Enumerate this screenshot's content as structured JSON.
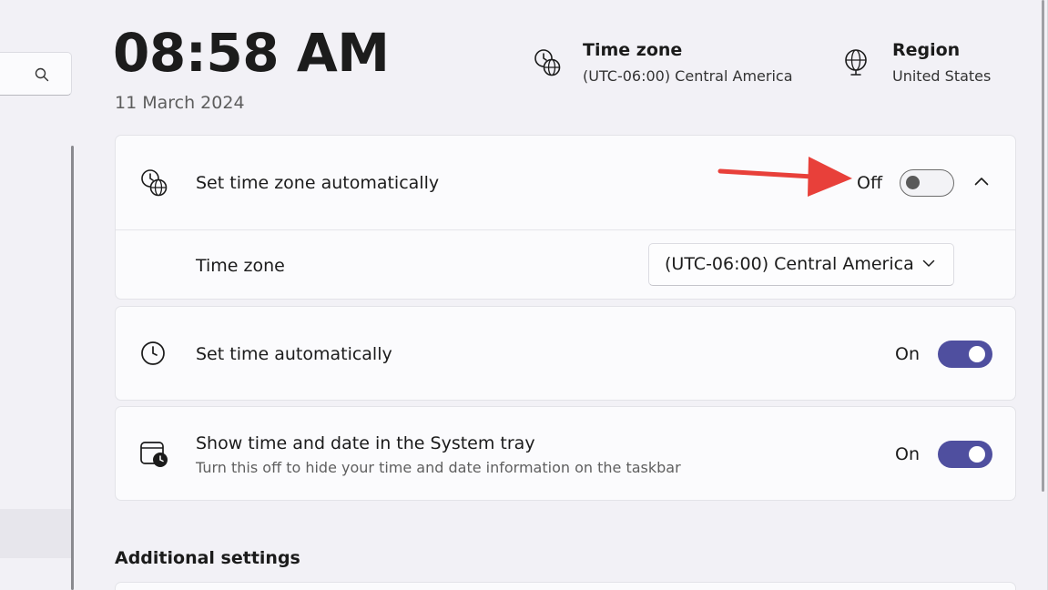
{
  "header": {
    "time": "08:58 AM",
    "date": "11 March 2024",
    "timezone": {
      "title": "Time zone",
      "value": "(UTC-06:00) Central America",
      "icon": "clock-globe-icon"
    },
    "region": {
      "title": "Region",
      "value": "United States",
      "icon": "globe-icon"
    }
  },
  "nav": {
    "search_icon": "search-icon"
  },
  "settings": {
    "auto_timezone": {
      "label": "Set time zone automatically",
      "state": "Off",
      "on": false,
      "icon": "clock-globe-icon",
      "expand_icon": "chevron-up-icon"
    },
    "timezone": {
      "label": "Time zone",
      "value": "(UTC-06:00) Central America",
      "dropdown_icon": "chevron-down-icon"
    },
    "auto_time": {
      "label": "Set time automatically",
      "state": "On",
      "on": true,
      "icon": "clock-icon"
    },
    "systray": {
      "label": "Show time and date in the System tray",
      "description": "Turn this off to hide your time and date information on the taskbar",
      "state": "On",
      "on": true,
      "icon": "calendar-clock-icon"
    }
  },
  "additional": {
    "title": "Additional settings"
  },
  "colors": {
    "accent": "#4f4f9f",
    "annotation": "#e8403a"
  }
}
